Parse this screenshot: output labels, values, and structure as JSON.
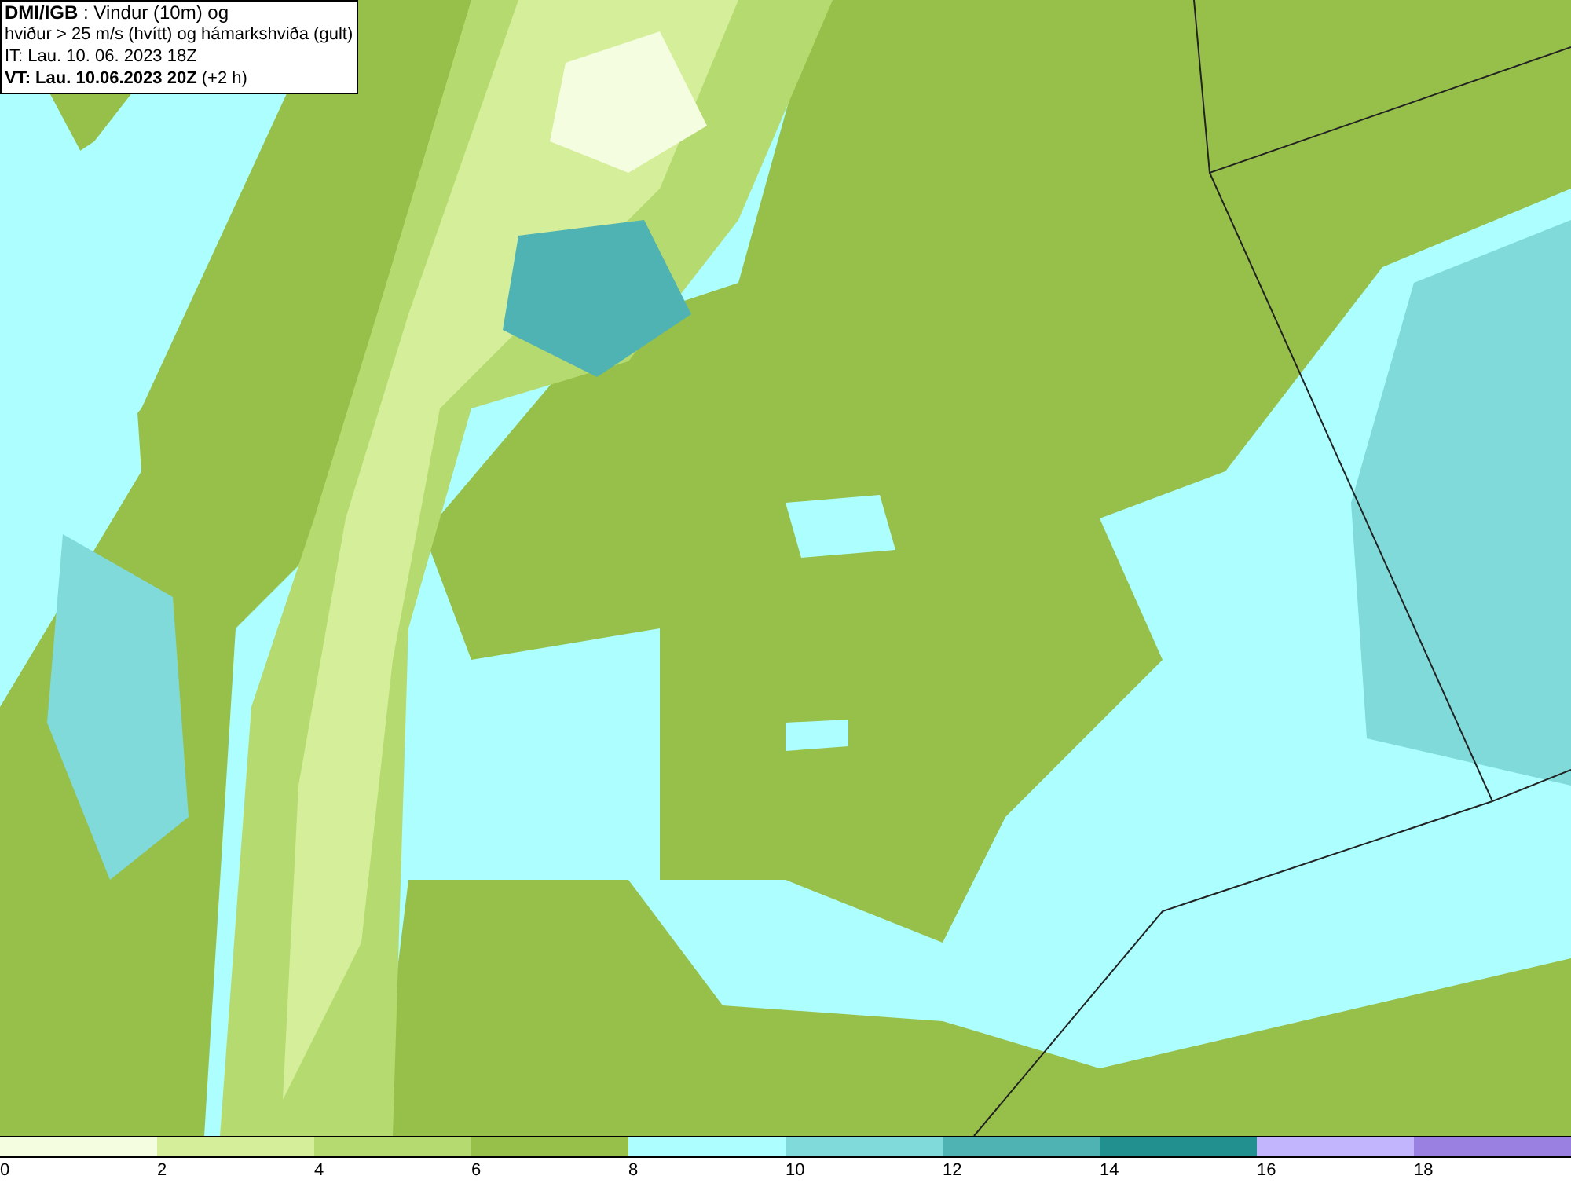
{
  "info_box": {
    "title_line": "**DMI/IGB** : Vindur (10m) og",
    "subtitle": "hviður > 25 m/s (hvítt) og hámarkshviða (gult)",
    "issue_time": "IT: Lau. 10. 06. 2023 18Z",
    "valid_time": "**VT: Lau. 10.06.2023 20Z** (+2 h)"
  },
  "legend": {
    "bins": [
      {
        "color": "#f5fde0",
        "label": "0"
      },
      {
        "color": "#d5ee9a",
        "label": "2"
      },
      {
        "color": "#b5db70",
        "label": "4"
      },
      {
        "color": "#97c04a",
        "label": "6"
      },
      {
        "color": "#adfefe",
        "label": "8"
      },
      {
        "color": "#80dada",
        "label": "10"
      },
      {
        "color": "#50b3b3",
        "label": "12"
      },
      {
        "color": "#239090",
        "label": "14"
      },
      {
        "color": "#c3b5fd",
        "label": "16"
      },
      {
        "color": "#9a80e0",
        "label": "18"
      }
    ]
  }
}
